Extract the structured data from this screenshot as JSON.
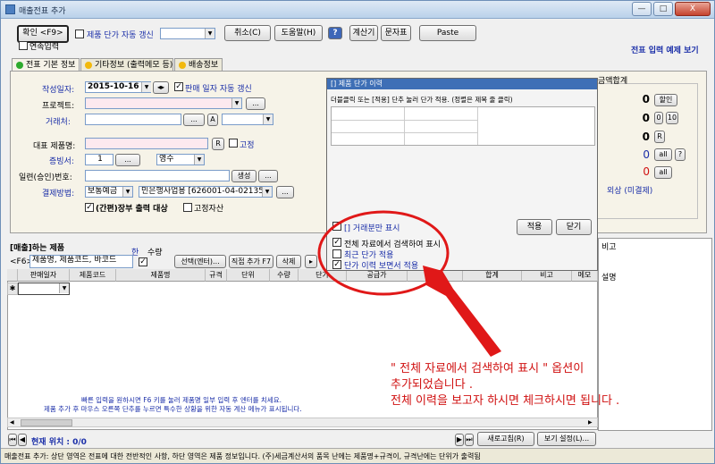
{
  "window": {
    "title": "매출전표 추가",
    "min": "—",
    "max": "□",
    "close": "X"
  },
  "toolbar": {
    "confirm": "확인 <F9>",
    "auto_link_label": "제품 단가 자동 갱신",
    "cancel": "취소(C)",
    "help": "도움말(H)",
    "calculator": "계산기",
    "sms": "문자표",
    "paste": "Paste",
    "continuous_label": "연속입력",
    "view_mode_link": "전표 입력 예제 보기"
  },
  "tabs": [
    {
      "label": "전표 기본 정보",
      "color": "#2eaa2e"
    },
    {
      "label": "기타정보 (출력메모 등)",
      "color": "#f2b90c"
    },
    {
      "label": "배송정보",
      "color": "#f2b90c"
    }
  ],
  "form": {
    "date_label": "작성일자:",
    "date_value": "2015-10-16",
    "sale_date_label": "판매 일자 자동 갱신",
    "project_label": "프로젝트:",
    "client_label": "거래처:",
    "product_label": "대표 제품명:",
    "fixed_label": "고정",
    "evidence_label": "증빙서:",
    "evidence_num": "1",
    "evidence_type": "영수",
    "approval_label": "일련(승인)번호:",
    "create_btn": "생성",
    "pay_label": "결제방법:",
    "pay_type": "보통예금",
    "pay_account": "민은행사업용 [626001-04-021358]",
    "print_label": "(간편)장부 출력 대상",
    "fixed_asset_label": "고정자산"
  },
  "summary": {
    "header": "금액합계",
    "values": [
      "0",
      "0",
      "0",
      "0",
      "0"
    ],
    "discount": "할인",
    "ten": "10",
    "r": "R",
    "all": "all",
    "q": "?",
    "credit_label": "외상 (미결제)"
  },
  "popup": {
    "title": "[] 제품 단가 이력",
    "desc": "더블클릭 또는 [적용] 단추 눌러 단가 적용. (정렬은 제목 줄 클릭)",
    "opt1": "[] 거래분만 표시",
    "opt2": "전체 자료에서 검색하여 표시",
    "opt3": "최근 단가 적용",
    "opt4": "단가 이력 보면서 적용",
    "apply": "적용",
    "close": "닫기"
  },
  "items": {
    "section_title": "[매출]하는 제품",
    "qty_label": "한",
    "qty_label2": "수량",
    "f6_label": "<F6>",
    "search_placeholder": "제품명, 제품코드, 바코드",
    "select_btn": "선택(엔터)...",
    "direct_btn": "직접 추가 F7",
    "delete_btn": "삭제",
    "columns": [
      "판매일자",
      "제품코드",
      "제품명",
      "규격",
      "단위",
      "수량",
      "단가",
      "공급가",
      "세액",
      "합계",
      "비고",
      "메모"
    ],
    "right_header": "비고",
    "right_sub": "설명",
    "hint1": "빠른 입력을 원하시면 F6 키를 눌러 제품명 일부 입력 후 엔터를 치세요.",
    "hint2": "제품 추가 후 마우스 오른쪽 단추를 누르면 특수한 상황을 위한 자동 계산 메뉴가 표시됩니다.",
    "position_label": "현재 위치 : 0/0",
    "refresh_btn": "새로고침(R)",
    "view_settings_btn": "보기 설정(L)..."
  },
  "status": "매출전표 추가: 상단 영역은 전표에 대한 전반적인 사항, 하단 영역은 제품 정보입니다. (주)세금계산서의 품목 난에는 제품명+규격이, 규격난에는 단위가 출력됨",
  "annotation": {
    "line1": "\" 전체 자료에서 검색하여 표시 \" 옵션이",
    "line2": "추가되었습니다 .",
    "line3": "전체 이력을 보고자 하시면 체크하시면 됩니다 ."
  }
}
